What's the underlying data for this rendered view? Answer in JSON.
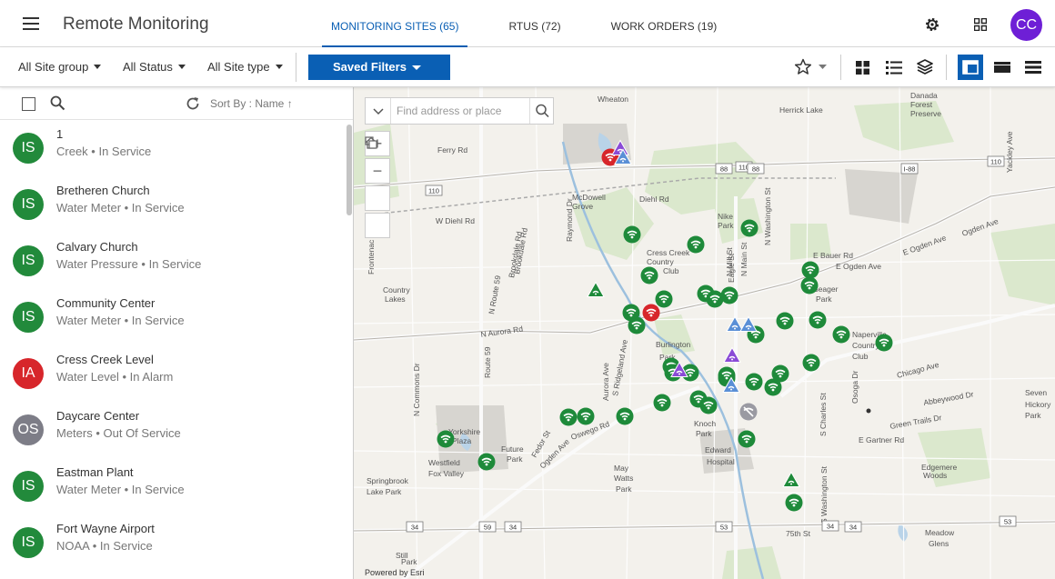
{
  "app": {
    "title": "Remote Monitoring",
    "avatar_initials": "CC"
  },
  "tabs": [
    {
      "label": "MONITORING SITES (65)"
    },
    {
      "label": "RTUS (72)"
    },
    {
      "label": "WORK ORDERS (19)"
    }
  ],
  "filters": {
    "site_group": "All Site group",
    "status": "All Status",
    "site_type": "All Site type",
    "saved_filters": "Saved Filters"
  },
  "list": {
    "sort_label": "Sort By : Name",
    "items": [
      {
        "initials": "IS",
        "name": "1",
        "sub": "Creek • In Service",
        "color": "#228a3b"
      },
      {
        "initials": "IS",
        "name": "Bretheren Church",
        "sub": "Water Meter • In Service",
        "color": "#228a3b"
      },
      {
        "initials": "IS",
        "name": "Calvary Church",
        "sub": "Water Pressure • In Service",
        "color": "#228a3b"
      },
      {
        "initials": "IS",
        "name": "Community Center",
        "sub": "Water Meter • In Service",
        "color": "#228a3b"
      },
      {
        "initials": "IA",
        "name": "Cress Creek Level",
        "sub": "Water Level • In Alarm",
        "color": "#d7262b"
      },
      {
        "initials": "OS",
        "name": "Daycare Center",
        "sub": "Meters • Out Of Service",
        "color": "#7d7d87"
      },
      {
        "initials": "IS",
        "name": "Eastman Plant",
        "sub": "Water Meter • In Service",
        "color": "#228a3b"
      },
      {
        "initials": "IS",
        "name": "Fort Wayne Airport",
        "sub": "NOAA • In Service",
        "color": "#228a3b"
      }
    ]
  },
  "map": {
    "search_placeholder": "Find address or place",
    "attribution": "Powered by Esri",
    "labels": [
      "Wheaton",
      "Danada",
      "Forest",
      "Preserve",
      "Herrick Lake",
      "Ferry Rd",
      "McDowell",
      "Grove",
      "Diehl Rd",
      "W Diehl Rd",
      "Cress Creek",
      "Country",
      "Club",
      "Nike",
      "Park",
      "E Bauer Rd",
      "Ogden Ave",
      "E Ogden Ave",
      "Country",
      "Lakes",
      "N Aurora Rd",
      "Burlington",
      "Park",
      "Seager",
      "Park",
      "Naperville",
      "Country",
      "Club",
      "Chicago Ave",
      "Abbeywood Dr",
      "Green Trails Dr",
      "E Gartner Rd",
      "Seven",
      "Hickory",
      "Park",
      "Yorkshire",
      "Plaza",
      "Westfield",
      "Fox Valley",
      "Future",
      "Park",
      "Ogden Ave",
      "Oswego Rd",
      "May",
      "Watts",
      "Park",
      "Springbrook",
      "Lake Park",
      "Knoch",
      "Park",
      "Edward",
      "Hospital",
      "Edgemere",
      "Woods",
      "75th St",
      "Meadow",
      "Glens",
      "Still",
      "Park",
      "Yackley Ave",
      "Aurora Ave",
      "N Route 59",
      "N Mill St",
      "N Main St",
      "S Charles St",
      "Osoga Dr",
      "Raymond Dr",
      "Brookdale Rd",
      "Frontenac Rd",
      "S Washington St",
      "N Washington St",
      "N Commons Dr",
      "Fedor St",
      "Route 59",
      "E Ogden Ave",
      "Eagle St",
      "Brookdale Rd",
      "S Ridgeland Ave"
    ],
    "shields": [
      "110",
      "88",
      "110",
      "88",
      "I-88",
      "110",
      "34",
      "59",
      "34",
      "53",
      "34",
      "53",
      "34"
    ],
    "pin_status_colors": {
      "in_service": "#1e8a3a",
      "in_alarm": "#d7262b",
      "out_of_service": "#9a9aa2",
      "site_a": "#8a4bd6",
      "site_b": "#5a8fd6"
    }
  }
}
